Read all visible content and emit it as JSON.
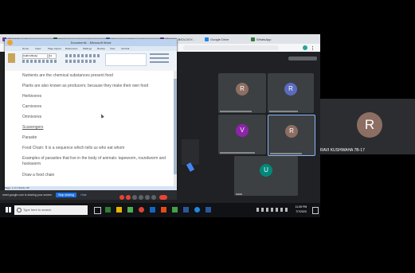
{
  "browser": {
    "tabs": [
      {
        "label": "Ⓜ N7 Eyes Real",
        "color": "#7b3fa0"
      },
      {
        "label": "Walk - learn, share, dis...",
        "color": "#2e7d32"
      },
      {
        "label": "Attendance UBiquantifo...",
        "color": "#4a7bd0"
      },
      {
        "label": "Ⓜ BIOE BIOLOGY...",
        "color": "#7b3fa0"
      },
      {
        "label": "Google Drive",
        "color": "#1e88e5"
      },
      {
        "label": "WhatsApp",
        "color": "#2e7d32"
      }
    ]
  },
  "word": {
    "title": "Document1 - Microsoft Word",
    "menu": [
      "Home",
      "Insert",
      "Page Layout",
      "References",
      "Mailings",
      "Review",
      "View",
      "Acrobat"
    ],
    "font_name": "Calibri (Body)",
    "font_size": "11",
    "document_lines": [
      "Nutrients are the chemical substances present food",
      "Plants are also known as producers; because they make their own food",
      "Herbivores",
      "Carnivores",
      "Omnivores",
      "Scavengers",
      "Parasite",
      "Food Chain: It is a sequence which tells us who eat whom",
      "Examples of parasites that live in the body of animals: tapeworm, roundworm and",
      "hookworm",
      "Draw a food chain"
    ],
    "status": "Page: 1 of 1   Words: 80"
  },
  "sharing_bar": {
    "text": "meet.google.com is sharing your screen",
    "stop_label": "Stop sharing",
    "hide_label": "Hide"
  },
  "taskbar": {
    "search_placeholder": "Type here to search",
    "time": "11:05 PM",
    "date": "7/7/2020"
  },
  "participants": [
    {
      "initial": "R",
      "color": "#8d6e63"
    },
    {
      "initial": "R",
      "color": "#5c6bc0"
    },
    {
      "initial": "V",
      "color": "#8e24aa"
    },
    {
      "initial": "R",
      "color": "#8d6e63"
    },
    {
      "initial": "U",
      "color": "#00897b"
    }
  ],
  "side_participant": {
    "initial": "R",
    "name": "RAVI KUSHWAHA 7B-17",
    "color": "#8d6e63"
  }
}
